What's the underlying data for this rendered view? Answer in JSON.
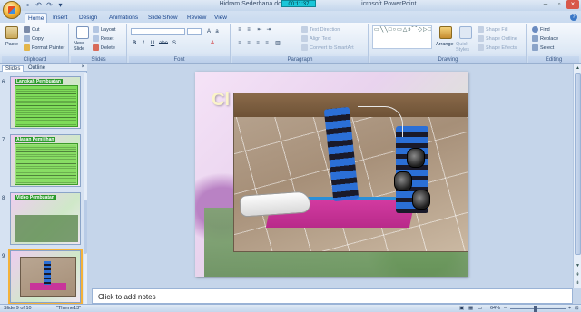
{
  "window": {
    "title": "Hidram Sederhana download from ",
    "title_suffix": "icrosoft PowerPoint",
    "timer": "00:11:37"
  },
  "tabs": [
    "Home",
    "Insert",
    "Design",
    "Animations",
    "Slide Show",
    "Review",
    "View"
  ],
  "ribbon": {
    "clipboard": {
      "paste": "Paste",
      "cut": "Cut",
      "copy": "Copy",
      "format_painter": "Format Painter",
      "label": "Clipboard"
    },
    "slides": {
      "new_slide": "New Slide",
      "layout": "Layout",
      "reset": "Reset",
      "delete": "Delete",
      "label": "Slides"
    },
    "font": {
      "label": "Font",
      "bold": "B",
      "italic": "I",
      "underline": "U",
      "strike": "abe",
      "shadow": "S"
    },
    "paragraph": {
      "text_direction": "Text Direction",
      "align_text": "Align Text",
      "convert_smartart": "Convert to SmartArt",
      "label": "Paragraph"
    },
    "drawing": {
      "arrange": "Arrange",
      "quick_styles": "Quick Styles",
      "shape_fill": "Shape Fill",
      "shape_outline": "Shape Outline",
      "shape_effects": "Shape Effects",
      "label": "Drawing"
    },
    "editing": {
      "find": "Find",
      "replace": "Replace",
      "select": "Select",
      "label": "Editing"
    }
  },
  "left_panel": {
    "tabs": [
      "Slides",
      "Outline"
    ],
    "close": "×",
    "thumbnails": [
      {
        "num": "6",
        "title": "Langkah Pembuatan"
      },
      {
        "num": "7",
        "title": "Alasan Pemilihan"
      },
      {
        "num": "8",
        "title": "Video Pembuatan"
      },
      {
        "num": "9",
        "title": ""
      }
    ]
  },
  "slide": {
    "title_fragment": "Cl"
  },
  "notes": {
    "placeholder": "Click to add notes"
  },
  "status": {
    "slide_of": "Slide 9 of 10",
    "theme": "\"Theme13\"",
    "zoom": "64%"
  }
}
